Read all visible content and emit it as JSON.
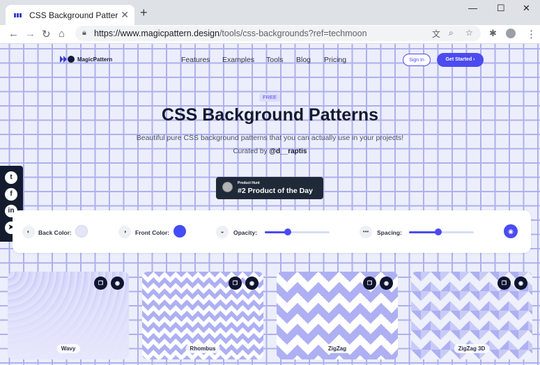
{
  "browser": {
    "tab_title": "CSS Background Patterns by M",
    "new_tab": "+",
    "close_tab": "✕",
    "window_controls": {
      "minimize": "—",
      "maximize": "☐",
      "close": "✕"
    },
    "url_host": "https://www.magicpattern.design",
    "url_path": "/tools/css-backgrounds?ref=techmoon",
    "icons": [
      "back-icon",
      "forward-icon",
      "reload-icon",
      "home-icon",
      "lock-icon",
      "translate-icon",
      "zoom-icon",
      "star-icon",
      "extensions-icon",
      "profile-icon",
      "menu-icon"
    ]
  },
  "site": {
    "logo_text": "MagicPattern",
    "nav": [
      "Features",
      "Examples",
      "Tools",
      "Blog",
      "Pricing"
    ],
    "sign_in": "Sign In",
    "get_started": "Get Started  ›"
  },
  "hero": {
    "badge": "FREE",
    "title": "CSS Background Patterns",
    "subtitle": "Beautiful pure CSS background patterns that you can actually use in your projects!",
    "curated_prefix": "Curated by",
    "curated_handle": "@d__raptis"
  },
  "product_hunt": {
    "small": "Product Hunt",
    "big": "#2 Product of the Day"
  },
  "social": [
    "twitter-icon",
    "facebook-icon",
    "linkedin-icon",
    "telegram-icon"
  ],
  "controls": {
    "back_color_label": "Back Color:",
    "back_color": "#e5e5f7",
    "front_color_label": "Front Color:",
    "front_color": "#444cf7",
    "opacity_label": "Opacity:",
    "opacity_value": 0.35,
    "spacing_label": "Spacing:",
    "spacing_value": 0.45
  },
  "colors": {
    "accent": "#4b4bf0",
    "dark": "#151a33",
    "grid": "#aeb0ec"
  },
  "patterns": [
    "Wavy",
    "Rhombus",
    "ZigZag",
    "ZigZag 3D"
  ]
}
